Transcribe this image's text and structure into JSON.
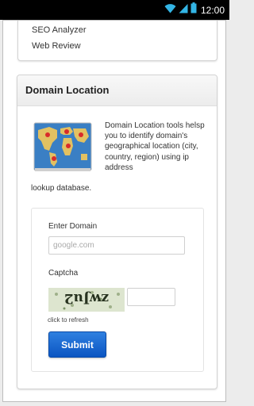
{
  "status_bar": {
    "time": "12:00"
  },
  "menu": {
    "items": [
      {
        "label": "SEO Analyzer"
      },
      {
        "label": "Web Review"
      }
    ]
  },
  "domain_location": {
    "title": "Domain Location",
    "description": "Domain Location tools helsp you to identify domain's geographical location (city, country, region) using ip address",
    "description_tail": "lookup database."
  },
  "form": {
    "domain_label": "Enter Domain",
    "domain_placeholder": "google.com",
    "domain_value": "",
    "captcha_label": "Captcha",
    "captcha_text": "zwJu2",
    "captcha_value": "",
    "refresh_label": "click to refresh",
    "submit_label": "Submit"
  },
  "colors": {
    "accent": "#0b55c2",
    "status_bar": "#000000",
    "status_icon": "#33b5e5"
  },
  "icons": {
    "wifi": "wifi-icon",
    "signal": "signal-icon",
    "battery": "battery-icon",
    "map": "world-map-icon"
  }
}
